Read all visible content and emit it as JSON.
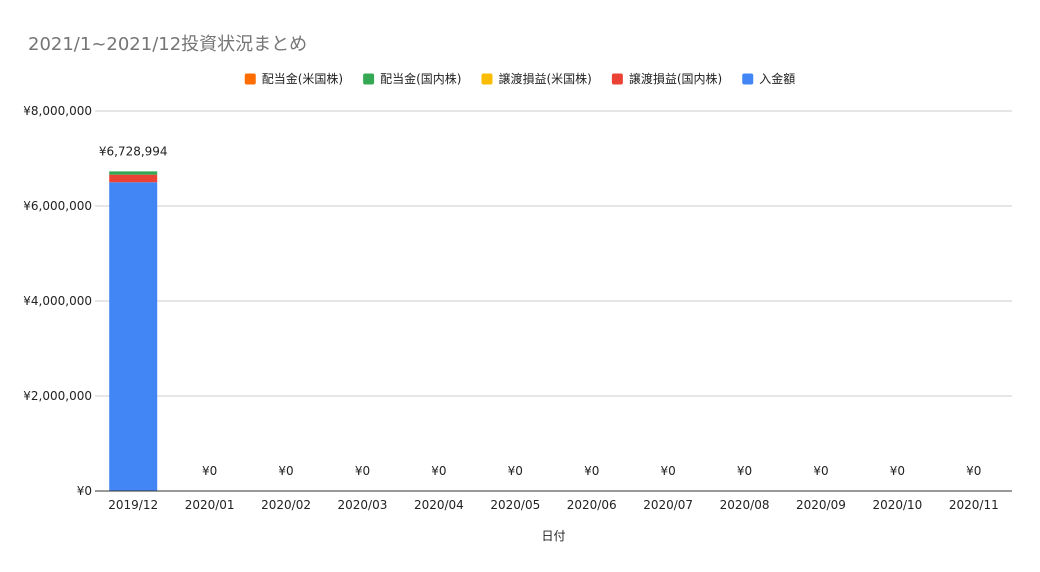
{
  "chart_data": {
    "type": "bar",
    "stacked": true,
    "title": "2021/1~2021/12投資状況まとめ",
    "xlabel": "日付",
    "ylabel": "",
    "ylim": [
      0,
      8000000
    ],
    "yticks": [
      0,
      2000000,
      4000000,
      6000000,
      8000000
    ],
    "ytick_labels": [
      "¥0",
      "¥2,000,000",
      "¥4,000,000",
      "¥6,000,000",
      "¥8,000,000"
    ],
    "grid": true,
    "legend_position": "top",
    "categories": [
      "2019/12",
      "2020/01",
      "2020/02",
      "2020/03",
      "2020/04",
      "2020/05",
      "2020/06",
      "2020/07",
      "2020/08",
      "2020/09",
      "2020/10",
      "2020/11"
    ],
    "series": [
      {
        "name": "入金額",
        "color": "#4285f4",
        "values": [
          6500000,
          0,
          0,
          0,
          0,
          0,
          0,
          0,
          0,
          0,
          0,
          0
        ]
      },
      {
        "name": "譲渡損益(国内株)",
        "color": "#ea4335",
        "values": [
          160000,
          0,
          0,
          0,
          0,
          0,
          0,
          0,
          0,
          0,
          0,
          0
        ]
      },
      {
        "name": "譲渡損益(米国株)",
        "color": "#fbbc04",
        "values": [
          0,
          0,
          0,
          0,
          0,
          0,
          0,
          0,
          0,
          0,
          0,
          0
        ]
      },
      {
        "name": "配当金(国内株)",
        "color": "#34a853",
        "values": [
          68994,
          0,
          0,
          0,
          0,
          0,
          0,
          0,
          0,
          0,
          0,
          0
        ]
      },
      {
        "name": "配当金(米国株)",
        "color": "#ff6d01",
        "values": [
          0,
          0,
          0,
          0,
          0,
          0,
          0,
          0,
          0,
          0,
          0,
          0
        ]
      }
    ],
    "legend_order": [
      "配当金(米国株)",
      "配当金(国内株)",
      "譲渡損益(米国株)",
      "譲渡損益(国内株)",
      "入金額"
    ],
    "total_labels": [
      "¥6,728,994",
      "¥0",
      "¥0",
      "¥0",
      "¥0",
      "¥0",
      "¥0",
      "¥0",
      "¥0",
      "¥0",
      "¥0",
      "¥0"
    ]
  }
}
